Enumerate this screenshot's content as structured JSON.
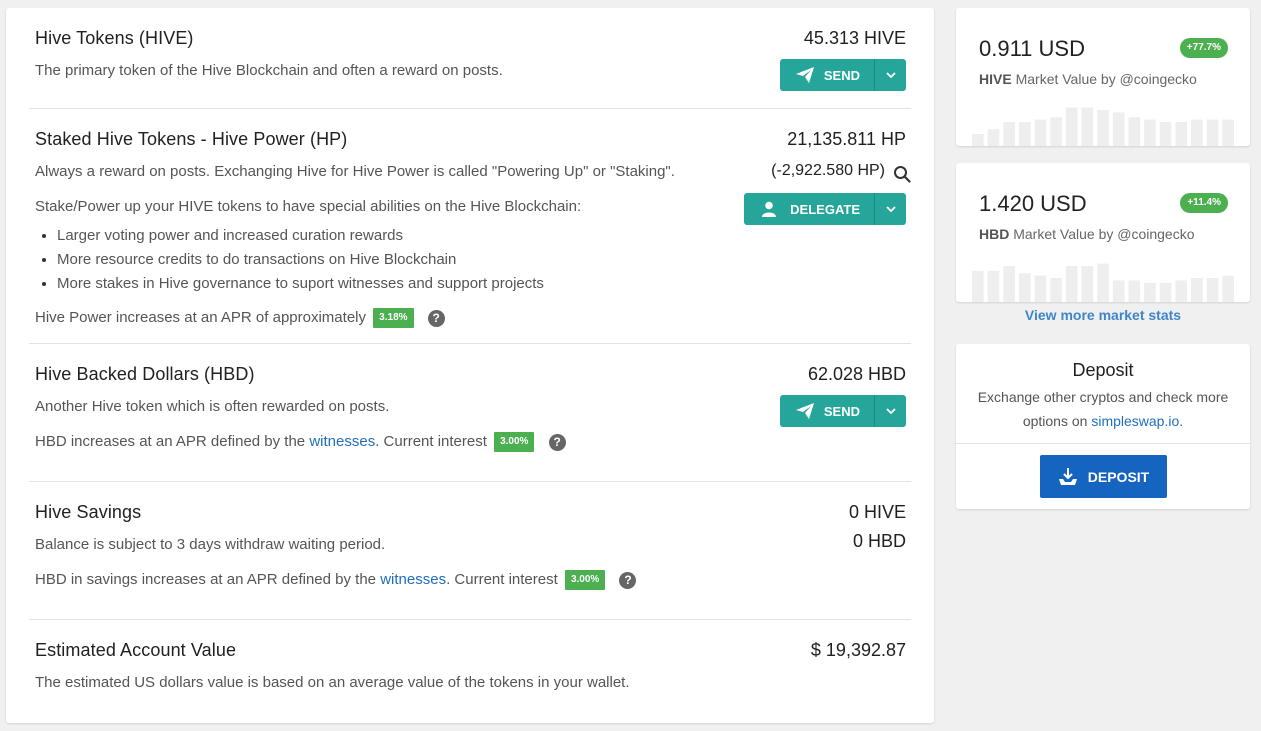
{
  "sections": {
    "hive": {
      "title": "Hive Tokens (HIVE)",
      "description": "The primary token of the Hive Blockchain and often a reward on posts.",
      "amount": "45.313 HIVE",
      "button_label": "SEND"
    },
    "hp": {
      "title": "Staked Hive Tokens - Hive Power (HP)",
      "description": "Always a reward on posts. Exchanging Hive for Hive Power is called \"Powering Up\" or \"Staking\".",
      "description2": "Stake/Power up your HIVE tokens to have special abilities on the Hive Blockchain:",
      "bullets": [
        "Larger voting power and increased curation rewards",
        "More resource credits to do transactions on Hive Blockchain",
        "More stakes in Hive governance to suport witnesses and support projects"
      ],
      "apr_text": "Hive Power increases at an APR of approximately",
      "apr_value": "3.18%",
      "amount": "21,135.811 HP",
      "delegated": "(-2,922.580 HP)",
      "button_label": "DELEGATE"
    },
    "hbd": {
      "title": "Hive Backed Dollars (HBD)",
      "description": "Another Hive token which is often rewarded on posts.",
      "apr_text_before": "HBD increases at an APR defined by the",
      "apr_link": "witnesses",
      "apr_text_after": ". Current interest",
      "apr_value": "3.00%",
      "amount": "62.028 HBD",
      "button_label": "SEND"
    },
    "savings": {
      "title": "Hive Savings",
      "description": "Balance is subject to 3 days withdraw waiting period.",
      "apr_text_before": "HBD in savings increases at an APR defined by the",
      "apr_link": "witnesses",
      "apr_text_after": ". Current interest",
      "apr_value": "3.00%",
      "amount_hive": "0 HIVE",
      "amount_hbd": "0 HBD"
    },
    "estimated": {
      "title": "Estimated Account Value",
      "description": "The estimated US dollars value is based on an average value of the tokens in your wallet.",
      "amount": "$ 19,392.87"
    }
  },
  "help_glyph": "?",
  "market": {
    "hive": {
      "price": "0.911 USD",
      "change": "+77.7%",
      "token": "HIVE",
      "label": "Market Value by @coingecko",
      "trend": [
        0.25,
        0.35,
        0.5,
        0.5,
        0.55,
        0.6,
        0.8,
        0.8,
        0.75,
        0.7,
        0.6,
        0.55,
        0.5,
        0.5,
        0.55,
        0.55,
        0.55
      ]
    },
    "hbd": {
      "price": "1.420 USD",
      "change": "+11.4%",
      "token": "HBD",
      "label": "Market Value by @coingecko",
      "trend": [
        0.65,
        0.65,
        0.75,
        0.6,
        0.55,
        0.5,
        0.75,
        0.75,
        0.8,
        0.45,
        0.45,
        0.4,
        0.4,
        0.45,
        0.5,
        0.5,
        0.55
      ]
    }
  },
  "view_more": "View more market stats",
  "deposit": {
    "title": "Deposit",
    "desc_line1": "Exchange other cryptos and check more",
    "desc_prefix": "options on",
    "desc_link": "simpleswap.io",
    "desc_suffix": ".",
    "button_label": "DEPOSIT"
  },
  "colors": {
    "action_button": "#26a69a",
    "apr_badge": "#4caf50",
    "deposit_button": "#1565c0",
    "link": "#1e6fbd"
  }
}
